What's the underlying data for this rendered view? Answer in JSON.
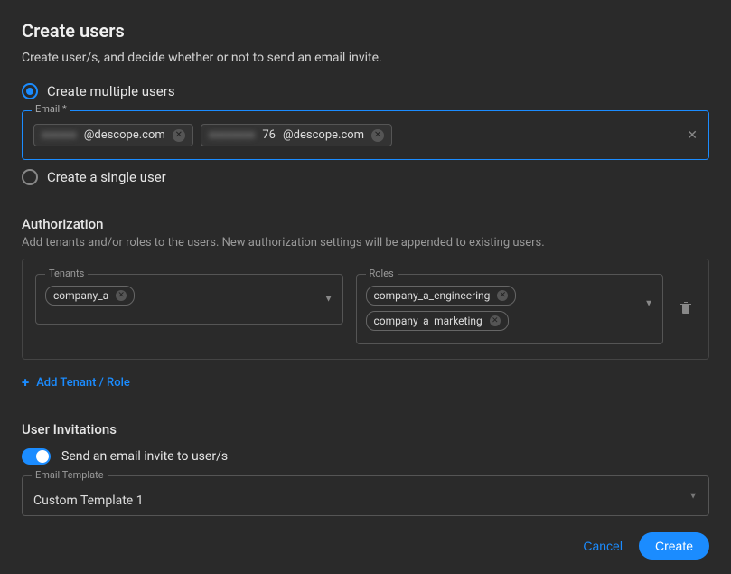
{
  "header": {
    "title": "Create users",
    "subtitle": "Create user/s, and decide whether or not to send an email invite."
  },
  "mode": {
    "multiple_label": "Create multiple users",
    "single_label": "Create a single user"
  },
  "email_field": {
    "legend": "Email *",
    "chips": [
      {
        "prefix": "",
        "suffix": "@descope.com"
      },
      {
        "prefix": "76",
        "suffix": "@descope.com"
      }
    ]
  },
  "authorization": {
    "title": "Authorization",
    "description": "Add tenants and/or roles to the users. New authorization settings will be appended to existing users.",
    "tenants_legend": "Tenants",
    "roles_legend": "Roles",
    "tenant_chips": [
      "company_a"
    ],
    "role_chips": [
      "company_a_engineering",
      "company_a_marketing"
    ],
    "add_link": "Add Tenant / Role"
  },
  "invitations": {
    "title": "User Invitations",
    "toggle_label": "Send an email invite to user/s",
    "template_legend": "Email Template",
    "template_value": "Custom Template 1"
  },
  "footer": {
    "cancel": "Cancel",
    "create": "Create"
  }
}
